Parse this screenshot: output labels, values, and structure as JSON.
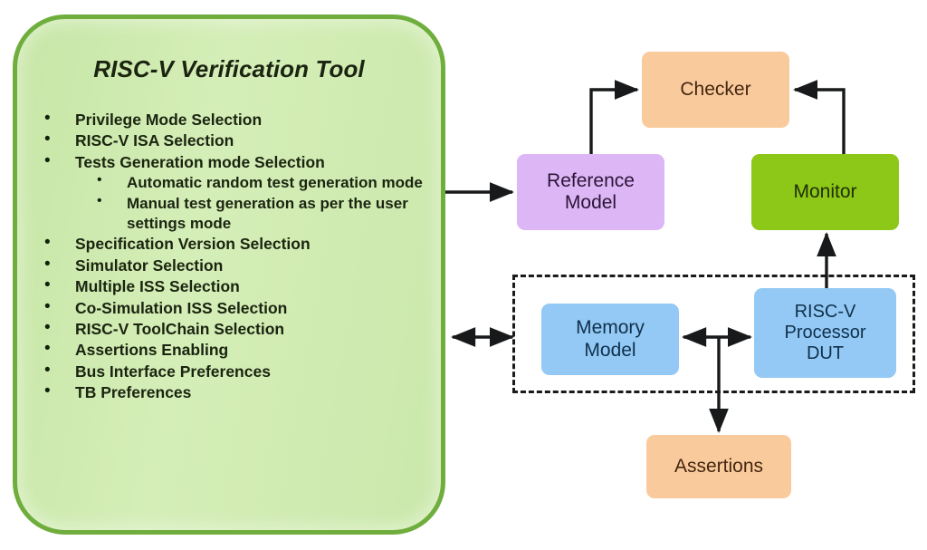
{
  "panel": {
    "title": "RISC-V Verification Tool",
    "bullet_glyph": "•",
    "accent_border_color": "#6fae3d",
    "fill_color": "#cbe8ab",
    "items": [
      {
        "level": 1,
        "label": "Privilege Mode Selection"
      },
      {
        "level": 1,
        "label": "RISC-V ISA Selection"
      },
      {
        "level": 1,
        "label": "Tests Generation mode Selection"
      },
      {
        "level": 2,
        "label": "Automatic random test generation mode"
      },
      {
        "level": 2,
        "label": "Manual test generation as per the user settings mode"
      },
      {
        "level": 1,
        "label": "Specification Version Selection"
      },
      {
        "level": 1,
        "label": "Simulator Selection"
      },
      {
        "level": 1,
        "label": "Multiple ISS Selection"
      },
      {
        "level": 1,
        "label": "Co-Simulation ISS Selection"
      },
      {
        "level": 1,
        "label": "RISC-V ToolChain Selection"
      },
      {
        "level": 1,
        "label": "Assertions Enabling"
      },
      {
        "level": 1,
        "label": "Bus Interface Preferences"
      },
      {
        "level": 1,
        "label": "TB Preferences"
      }
    ]
  },
  "testbench": {
    "blocks": {
      "checker": {
        "label": "Checker",
        "color": "#f9cb9c"
      },
      "reference_model": {
        "label": "Reference Model",
        "line1": "Reference",
        "line2": "Model",
        "color": "#ddb6f5"
      },
      "monitor": {
        "label": "Monitor",
        "color": "#8dc818"
      },
      "memory_model": {
        "label": "Memory Model",
        "line1": "Memory",
        "line2": "Model",
        "color": "#93c9f4"
      },
      "processor_dut": {
        "label": "RISC-V Processor DUT",
        "line1": "RISC-V",
        "line2": "Processor",
        "line3": "DUT",
        "color": "#93c9f4"
      },
      "assertions": {
        "label": "Assertions",
        "color": "#f9cb9c"
      }
    },
    "boundary": {
      "style": "dashed",
      "color": "#1a1a1a"
    },
    "connections": [
      {
        "from": "RISC-V Verification Tool",
        "to": "Reference Model",
        "direction": "one-way"
      },
      {
        "from": "RISC-V Verification Tool",
        "to": "DUT environment",
        "direction": "two-way"
      },
      {
        "from": "Reference Model",
        "to": "Checker",
        "direction": "one-way"
      },
      {
        "from": "Monitor",
        "to": "Checker",
        "direction": "one-way"
      },
      {
        "from": "RISC-V Processor DUT",
        "to": "Monitor",
        "direction": "one-way"
      },
      {
        "from": "Memory Model",
        "to": "RISC-V Processor DUT",
        "direction": "two-way"
      },
      {
        "from": "Memory Model / DUT bus",
        "to": "Assertions",
        "direction": "one-way"
      }
    ]
  }
}
